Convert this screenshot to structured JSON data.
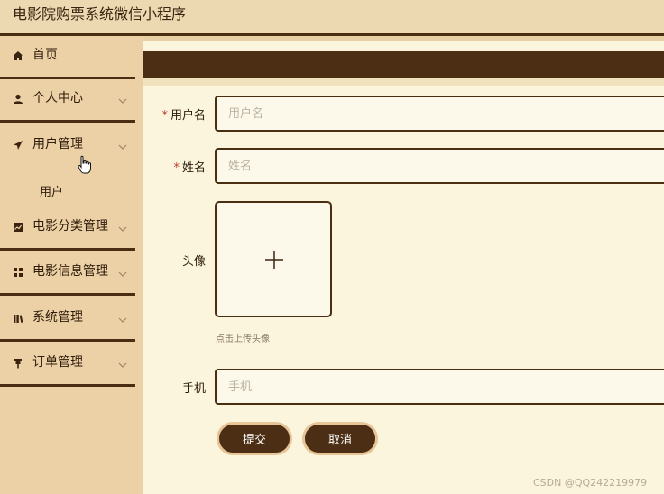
{
  "app": {
    "title": "电影院购票系统微信小程序"
  },
  "sidebar": {
    "items": [
      {
        "label": "首页",
        "icon": "home-icon"
      },
      {
        "label": "个人中心",
        "icon": "person-icon"
      },
      {
        "label": "用户管理",
        "icon": "send-icon"
      },
      {
        "label": "电影分类管理",
        "icon": "chart-icon"
      },
      {
        "label": "电影信息管理",
        "icon": "grid-icon"
      },
      {
        "label": "系统管理",
        "icon": "library-icon"
      },
      {
        "label": "订单管理",
        "icon": "pin-icon"
      }
    ],
    "sub_items": [
      {
        "label": "用户"
      }
    ]
  },
  "form": {
    "username": {
      "label": "用户名",
      "placeholder": "用户名",
      "value": ""
    },
    "name": {
      "label": "姓名",
      "placeholder": "姓名",
      "value": ""
    },
    "avatar": {
      "label": "头像",
      "hint": "点击上传头像"
    },
    "phone": {
      "label": "手机",
      "placeholder": "手机",
      "value": ""
    }
  },
  "buttons": {
    "submit": "提交",
    "cancel": "取消"
  },
  "watermark": "CSDN @QQ242219979",
  "colors": {
    "accent": "#4b2e14",
    "background": "#fbf5de",
    "sidebar": "#ecd0a6",
    "required": "#c0392b"
  }
}
